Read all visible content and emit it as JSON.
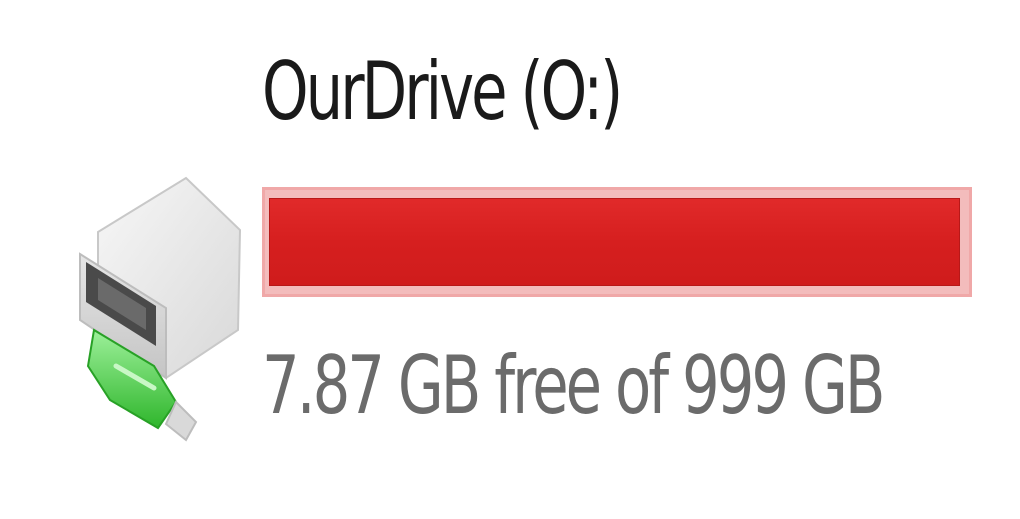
{
  "drive": {
    "name": "OurDrive (O:)",
    "free_text": "7.87 GB free of 999 GB",
    "used_fraction": 0.9921,
    "icon": "network-drive-icon",
    "bar_color": "#d61f1f",
    "bar_background": "#f3bcbc"
  }
}
